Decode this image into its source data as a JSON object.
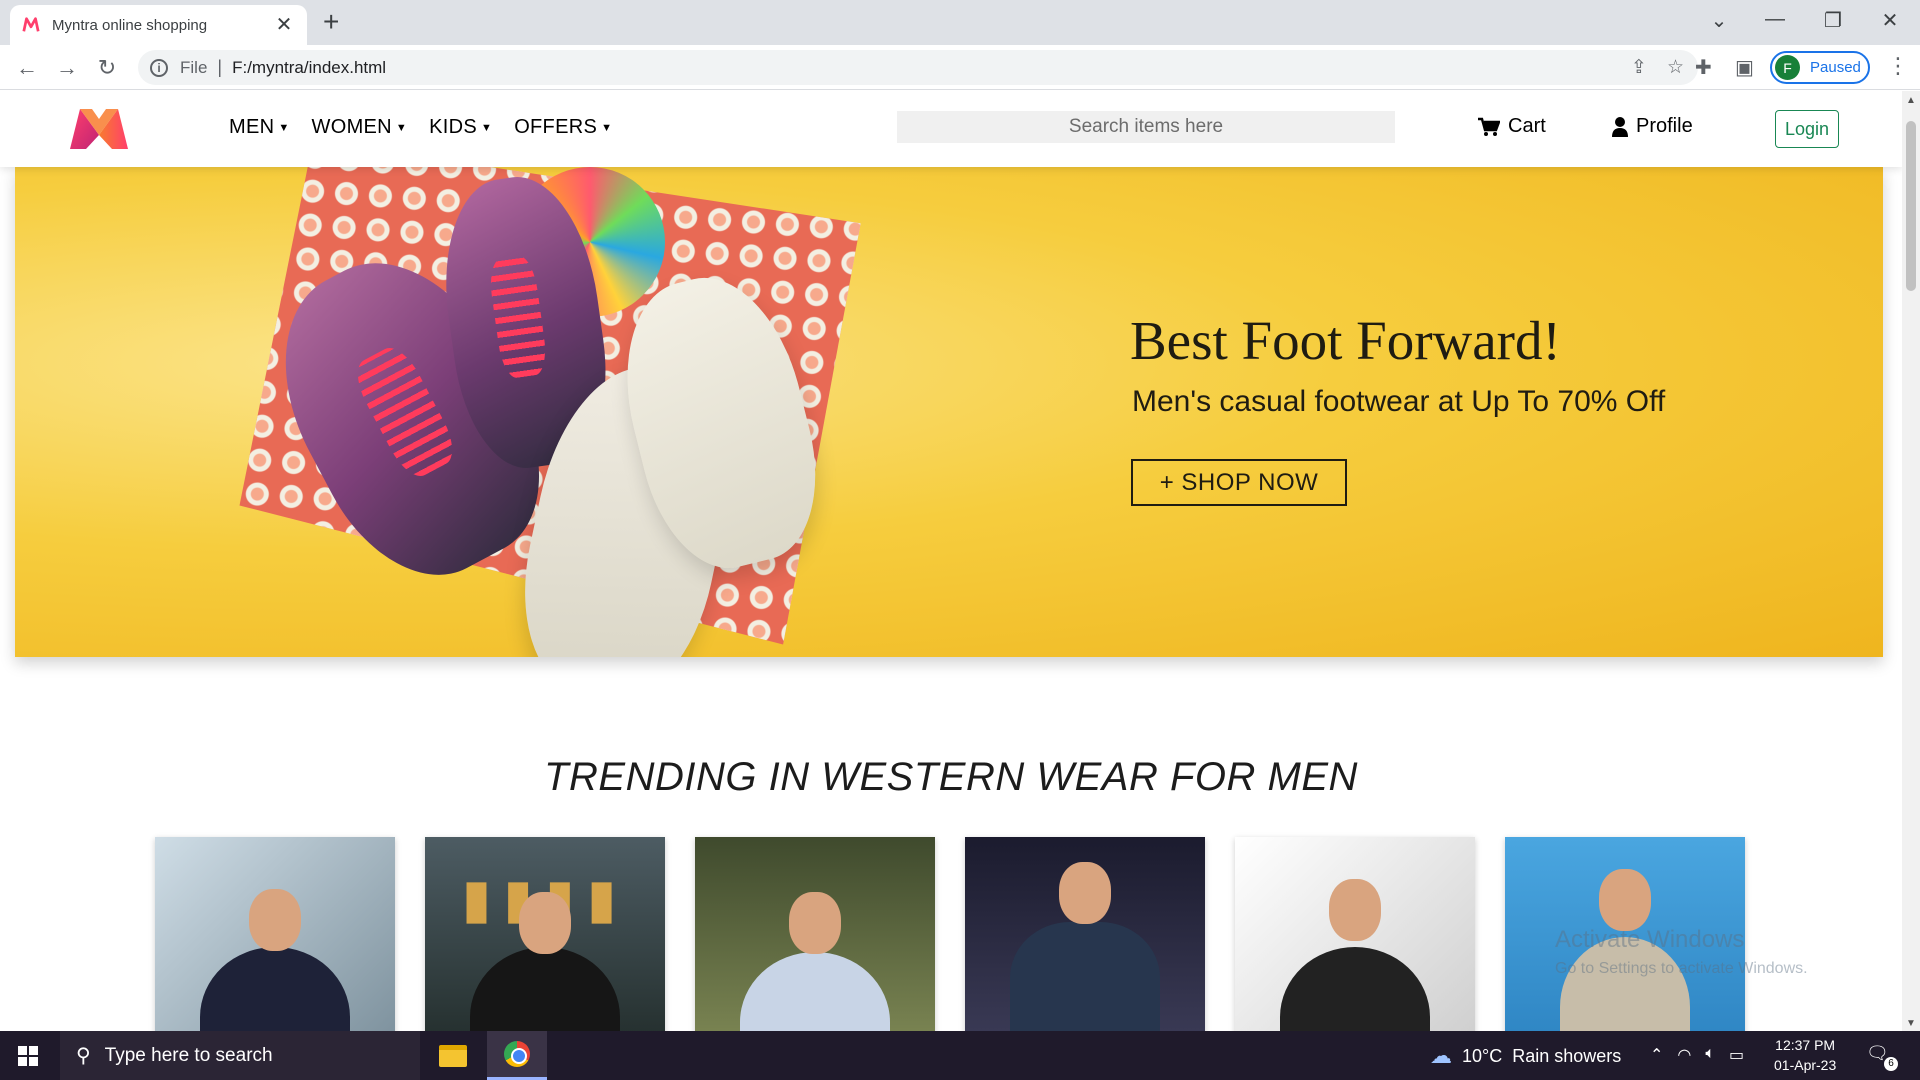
{
  "browser": {
    "tab_title": "Myntra online shopping",
    "tab_close": "✕",
    "new_tab": "+",
    "file_label": "File",
    "url_separator": "|",
    "url": "F:/myntra/index.html",
    "profile_initial": "F",
    "profile_status": "Paused",
    "accent_color": "#1a73e8"
  },
  "site": {
    "brand_colors": [
      "#ff3f6c",
      "#f87b2e",
      "#c02474"
    ],
    "menu": [
      {
        "label": "MEN"
      },
      {
        "label": "WOMEN"
      },
      {
        "label": "KIDS"
      },
      {
        "label": "OFFERS"
      }
    ],
    "search_placeholder": "Search items here",
    "cart_label": "Cart",
    "profile_label": "Profile",
    "login_label": "Login",
    "login_color": "#198754"
  },
  "hero": {
    "title": "Best Foot Forward!",
    "subtitle": "Men's casual footwear at Up To 70% Off",
    "cta": "+ SHOP NOW",
    "background_color": "#f6cd3e"
  },
  "trending": {
    "title": "TRENDING IN WESTERN WEAR FOR MEN",
    "products": [
      {
        "name": "product-card-1",
        "bg": "#9fb3bf",
        "outfit": "#1e2238"
      },
      {
        "name": "product-card-2",
        "bg": "#3a4a52",
        "outfit": "#161616"
      },
      {
        "name": "product-card-3",
        "bg": "#56603d",
        "outfit": "#c8d4e6"
      },
      {
        "name": "product-card-4",
        "bg": "#23233a",
        "outfit": "#27364e"
      },
      {
        "name": "product-card-5",
        "bg": "#e9e9e9",
        "outfit": "#222222"
      },
      {
        "name": "product-card-6",
        "bg": "#3f9ad8",
        "outfit": "#c7bda9"
      }
    ]
  },
  "watermark": {
    "title": "Activate Windows",
    "subtitle": "Go to Settings to activate Windows."
  },
  "taskbar": {
    "search_placeholder": "Type here to search",
    "weather_temp": "10°C",
    "weather_text": "Rain showers",
    "time": "12:37 PM",
    "date": "01-Apr-23",
    "notification_count": "6"
  }
}
